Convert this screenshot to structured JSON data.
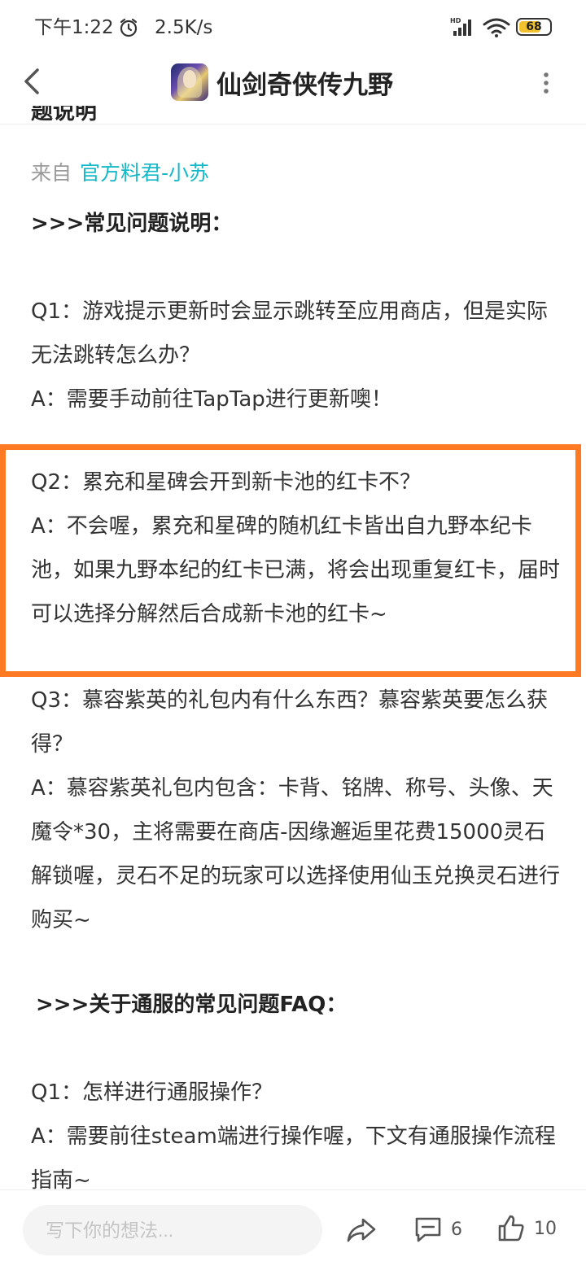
{
  "status_bar": {
    "time": "下午1:22",
    "speed": "2.5K/s",
    "battery": "68",
    "battery_level": 0.68,
    "icons": [
      "alarm-icon",
      "hd-signal-icon",
      "wifi-icon",
      "battery-icon"
    ]
  },
  "header": {
    "title": "仙剑奇侠传九野",
    "back_icon": "chevron-left-icon",
    "more_icon": "more-vertical-icon"
  },
  "article": {
    "partial_title": "题说明",
    "source_prefix": "来自",
    "source_author": "官方料君-小苏",
    "section1_heading": ">>>常见问题说明：",
    "q1": "Q1：游戏提示更新时会显示跳转至应用商店，但是实际无法跳转怎么办？",
    "a1": "A：需要手动前往TapTap进行更新噢！",
    "q2": "Q2：累充和星碑会开到新卡池的红卡不？",
    "a2": "A：不会喔，累充和星碑的随机红卡皆出自九野本纪卡池，如果九野本纪的红卡已满，将会出现重复红卡，届时可以选择分解然后合成新卡池的红卡~",
    "q3": "Q3：慕容紫英的礼包内有什么东西？慕容紫英要怎么获得？",
    "a3": "A：慕容紫英礼包内包含：卡背、铭牌、称号、头像、天魔令*30，主将需要在商店-因缘邂逅里花费15000灵石解锁喔，灵石不足的玩家可以选择使用仙玉兑换灵石进行购买~",
    "section2_heading": ">>>关于通服的常见问题FAQ：",
    "faq_q1": "Q1：怎样进行通服操作？",
    "faq_a1": "A：需要前往steam端进行操作喔，下文有通服操作流程指南~",
    "highlight_color": "#ff7a23",
    "author_color": "#14b9c8"
  },
  "bottom_bar": {
    "comment_placeholder": "写下你的想法...",
    "comment_count": "6",
    "like_count": "10",
    "icons": [
      "share-icon",
      "comment-icon",
      "thumbs-up-icon"
    ]
  }
}
